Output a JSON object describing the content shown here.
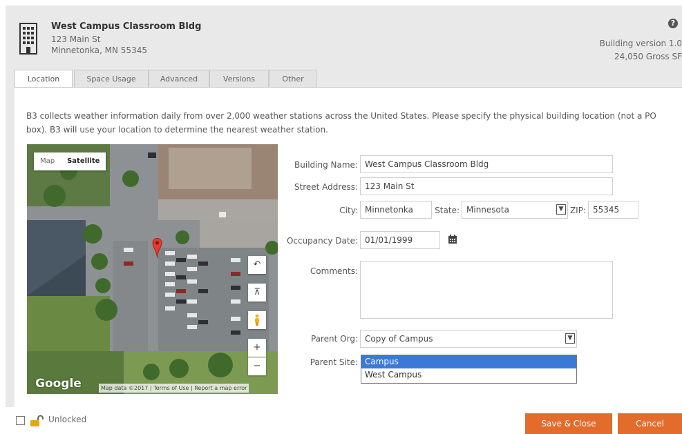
{
  "header": {
    "building_name": "West Campus Classroom Bldg",
    "address_line1": "123 Main St",
    "address_line2": "Minnetonka, MN 55345",
    "version": "Building version 1.0",
    "gross_sf": "24,050 Gross SF"
  },
  "tabs": [
    {
      "label": "Location"
    },
    {
      "label": "Space Usage"
    },
    {
      "label": "Advanced"
    },
    {
      "label": "Versions"
    },
    {
      "label": "Other"
    }
  ],
  "description": "B3 collects weather information daily from over 2,000 weather stations across the United States. Please specify the physical building location (not a PO box). B3 will use your location to determine the nearest weather station.",
  "map": {
    "type_map": "Map",
    "type_satellite": "Satellite",
    "google": "Google",
    "attribution": "Map data ©2017 | Terms of Use | Report a map error"
  },
  "form": {
    "building_name_label": "Building Name:",
    "building_name_value": "West Campus Classroom Bldg",
    "street_label": "Street Address:",
    "street_value": "123 Main St",
    "city_label": "City:",
    "city_value": "Minnetonka",
    "state_label": "State:",
    "state_value": "Minnesota",
    "zip_label": "ZIP:",
    "zip_value": "55345",
    "occupancy_label": "Occupancy Date:",
    "occupancy_value": "01/01/1999",
    "comments_label": "Comments:",
    "comments_value": "",
    "parent_org_label": "Parent Org:",
    "parent_org_value": "Copy of Campus",
    "parent_site_label": "Parent Site:",
    "parent_site_options": [
      "Campus",
      "West Campus"
    ]
  },
  "footer": {
    "unlocked": "Unlocked",
    "save": "Save & Close",
    "cancel": "Cancel"
  },
  "colors": {
    "accent": "#e36b2c",
    "selection": "#3a7ad6"
  }
}
